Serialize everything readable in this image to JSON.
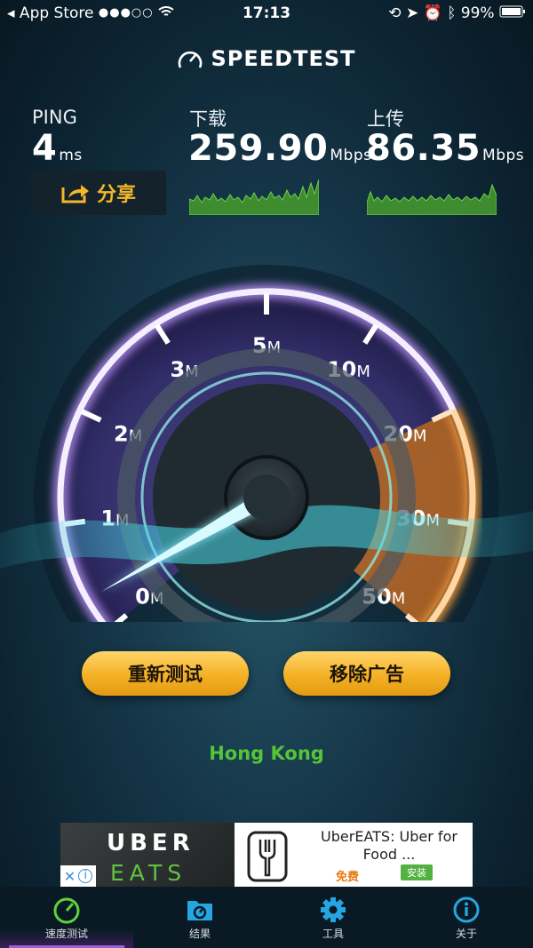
{
  "status_bar": {
    "back_app": "◂ App Store",
    "signal_dots": "●●●○○",
    "time": "17:13",
    "battery": "99%"
  },
  "header": {
    "logo": "SPEEDTEST"
  },
  "metrics": {
    "ping": {
      "label": "PING",
      "value": "4",
      "unit": "ms"
    },
    "download": {
      "label": "下载",
      "value": "259.90",
      "unit": "Mbps"
    },
    "upload": {
      "label": "上传",
      "value": "86.35",
      "unit": "Mbps"
    }
  },
  "share_button": {
    "label": "分享"
  },
  "gauge": {
    "ticks": [
      {
        "num": "0",
        "unit": "M"
      },
      {
        "num": "1",
        "unit": "M"
      },
      {
        "num": "2",
        "unit": "M"
      },
      {
        "num": "3",
        "unit": "M"
      },
      {
        "num": "5",
        "unit": "M"
      },
      {
        "num": "10",
        "unit": "M"
      },
      {
        "num": "20",
        "unit": "M"
      },
      {
        "num": "30",
        "unit": "M"
      },
      {
        "num": "50",
        "unit": "M"
      }
    ],
    "needle_value_mbps": 0
  },
  "buttons": {
    "retest": "重新测试",
    "remove_ads": "移除广告"
  },
  "server": {
    "location": "Hong Kong"
  },
  "ad": {
    "brand_top": "UBER",
    "brand_bottom": "EATS",
    "title": "UberEATS: Uber for Food ...",
    "free": "免费",
    "install": "安装"
  },
  "tabs": [
    {
      "label": "速度测试",
      "icon": "speedometer-icon",
      "active": true
    },
    {
      "label": "结果",
      "icon": "results-icon",
      "active": false
    },
    {
      "label": "工具",
      "icon": "gear-icon",
      "active": false
    },
    {
      "label": "关于",
      "icon": "info-icon",
      "active": false
    }
  ],
  "colors": {
    "accent_gold": "#f4b124",
    "server_green": "#55c437",
    "gauge_purple": "#9c6ad8",
    "gauge_orange": "#e78a2a"
  }
}
